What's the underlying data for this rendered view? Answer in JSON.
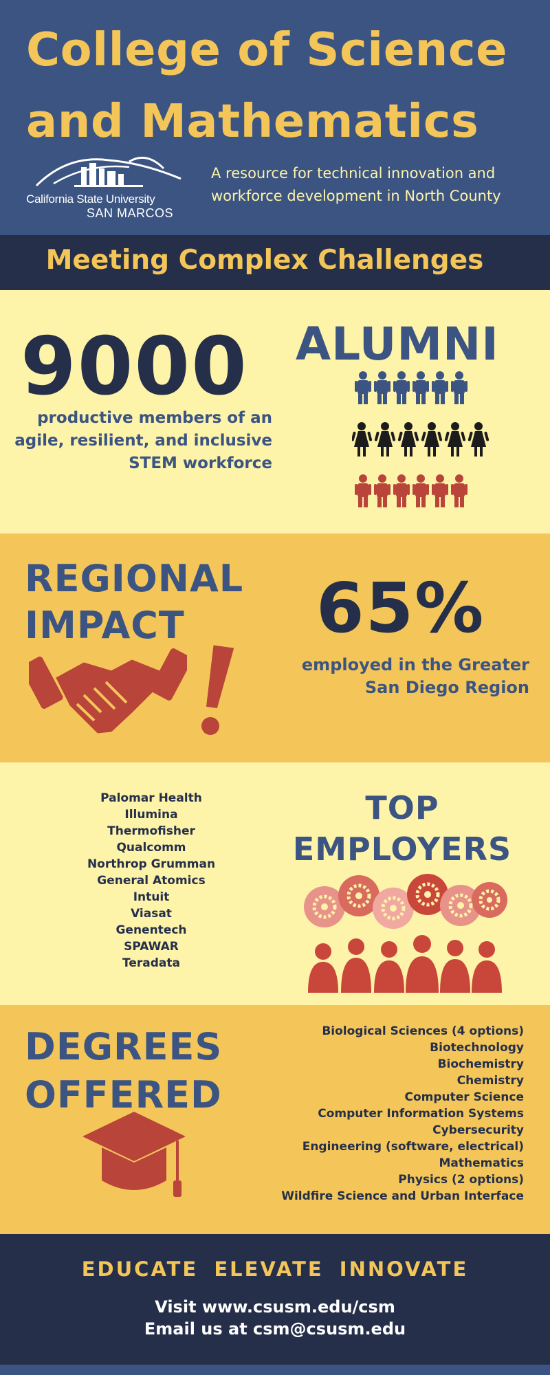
{
  "header": {
    "title_line1": "College of Science",
    "title_line2": "and Mathematics",
    "logo_name": "California State University",
    "logo_campus": "SAN MARCOS",
    "tagline_line1": "A resource for technical innovation and",
    "tagline_line2": "workforce development in North County"
  },
  "subheading": "Meeting Complex Challenges",
  "alumni": {
    "number": "9000",
    "label": "ALUMNI",
    "desc_line1": "productive members of an",
    "desc_line2": "agile, resilient, and inclusive",
    "desc_line3": "STEM workforce"
  },
  "regional": {
    "title_line1": "REGIONAL",
    "title_line2": "IMPACT",
    "percent": "65%",
    "desc_line1": "employed in the Greater",
    "desc_line2": "San Diego Region"
  },
  "employers": {
    "title_line1": "TOP",
    "title_line2": "EMPLOYERS",
    "list": [
      "Palomar Health",
      "Illumina",
      "Thermofisher",
      "Qualcomm",
      "Northrop Grumman",
      "General Atomics",
      "Intuit",
      "Viasat",
      "Genentech",
      "SPAWAR",
      "Teradata"
    ]
  },
  "degrees": {
    "title_line1": "DEGREES",
    "title_line2": "OFFERED",
    "list": [
      "Biological Sciences (4 options)",
      "Biotechnology",
      "Biochemistry",
      "Chemistry",
      "Computer Science",
      "Computer Information Systems",
      "Cybersecurity",
      "Engineering (software, electrical)",
      "Mathematics",
      "Physics (2 options)",
      "Wildfire Science and Urban Interface"
    ]
  },
  "footer": {
    "motto": "EDUCATE ELEVATE INNOVATE",
    "visit": "Visit www.csusm.edu/csm",
    "email": "Email us at csm@csusm.edu"
  },
  "colors": {
    "navy": "#3b5482",
    "dark_navy": "#252f4a",
    "gold": "#f4c659",
    "cream": "#fdf3a9",
    "red": "#b8443a"
  },
  "icons": [
    "university-logo",
    "people-icon",
    "handshake-icon",
    "exclamation-icon",
    "gears-icon",
    "graduation-cap-icon"
  ]
}
